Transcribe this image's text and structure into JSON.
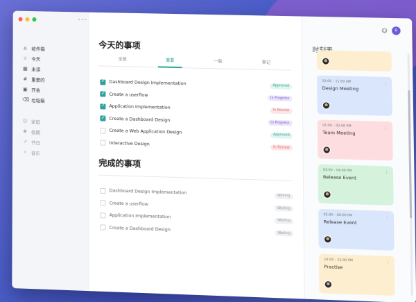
{
  "sidebar": {
    "items": [
      {
        "icon": "inbox-icon",
        "glyph": "⌂",
        "label": "收件箱"
      },
      {
        "icon": "star-icon",
        "glyph": "☆",
        "label": "今天"
      },
      {
        "icon": "calendar-icon",
        "glyph": "▦",
        "label": "未读"
      },
      {
        "icon": "hash-icon",
        "glyph": "#",
        "label": "重要的"
      },
      {
        "icon": "folder-icon",
        "glyph": "▣",
        "label": "开会"
      },
      {
        "icon": "trash-icon",
        "glyph": "⌫",
        "label": "垃圾箱"
      }
    ],
    "secondary": [
      {
        "icon": "users-icon",
        "glyph": "☺",
        "label": "家庭"
      },
      {
        "icon": "gear-icon",
        "glyph": "✱",
        "label": "假期"
      },
      {
        "icon": "trend-icon",
        "glyph": "↗",
        "label": "节日"
      },
      {
        "icon": "sparkle-icon",
        "glyph": "✧",
        "label": "音乐"
      }
    ]
  },
  "today": {
    "title": "今天的事项",
    "tabs": [
      {
        "label": "全部",
        "active": false
      },
      {
        "label": "重要",
        "active": true
      },
      {
        "label": "一般",
        "active": false
      },
      {
        "label": "事记",
        "active": false
      }
    ],
    "tasks": [
      {
        "label": "Dashboard Design Implementation",
        "checked": true,
        "status": "Approved",
        "status_type": "approved"
      },
      {
        "label": "Create a userflow",
        "checked": true,
        "status": "In Progress",
        "status_type": "progress"
      },
      {
        "label": "Application Implementation",
        "checked": true,
        "status": "In Review",
        "status_type": "review"
      },
      {
        "label": "Create a Dashboard Design",
        "checked": true,
        "status": "In Progress",
        "status_type": "progress"
      },
      {
        "label": "Create a Web Application Design",
        "checked": false,
        "status": "Approved",
        "status_type": "approved"
      },
      {
        "label": "Interactive Design",
        "checked": false,
        "status": "In Review",
        "status_type": "review"
      }
    ]
  },
  "completed": {
    "title": "完成的事项",
    "tasks": [
      {
        "label": "Dashboard Design Implementation",
        "status": "Waiting"
      },
      {
        "label": "Create a userflow",
        "status": "Waiting"
      },
      {
        "label": "Application Implementation",
        "status": "Waiting"
      },
      {
        "label": "Create a Dashboard Design",
        "status": "Waiting"
      }
    ]
  },
  "schedule": {
    "title": "时刻表",
    "header_avatar_text": "6",
    "cards": [
      {
        "time": "",
        "title": "",
        "color": "#fdeecf",
        "first": true
      },
      {
        "time": "10:00 – 11:00 AM",
        "title": "Design Meeting",
        "color": "#d9e6fb",
        "first": false
      },
      {
        "time": "01:00 – 02:00 PM",
        "title": "Team Meeting",
        "color": "#fddde0",
        "first": false
      },
      {
        "time": "03:00 – 04:00 PM",
        "title": "Release Event",
        "color": "#d5f3dc",
        "first": false
      },
      {
        "time": "05:00 – 06:00 PM",
        "title": "Release Event",
        "color": "#d9e6fb",
        "first": false
      },
      {
        "time": "10:00 – 12:00 PM",
        "title": "Practise",
        "color": "#fdeecf",
        "first": false
      }
    ]
  },
  "colors": {
    "accent": "#2ba39a",
    "brand": "#6a5bd6"
  }
}
